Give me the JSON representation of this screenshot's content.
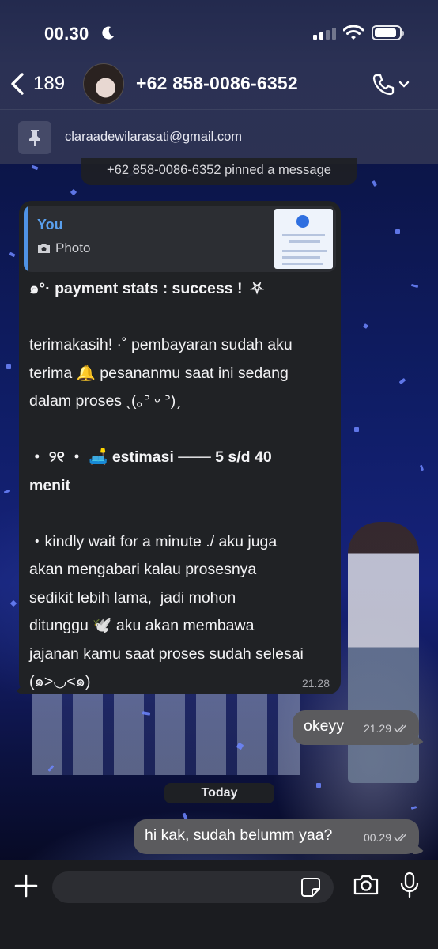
{
  "status_bar": {
    "time": "00.30",
    "icons": [
      "moon-icon",
      "signal-icon",
      "wifi-icon",
      "battery-icon"
    ]
  },
  "header": {
    "back_count": "189",
    "contact_name": "+62 858-0086-6352",
    "icons": [
      "chevron-left-icon",
      "phone-icon",
      "chevron-down-icon"
    ]
  },
  "pinned": {
    "text": "claraadewilarasati@gmail.com",
    "icon": "pin-icon"
  },
  "chat": {
    "system_notice": "+62 858-0086-6352 pinned a message",
    "incoming": {
      "reply_author": "You",
      "reply_type": "Photo",
      "lines": {
        "l1": "๑°· payment stats : success !  ⛧",
        "l2": "terimakasih! ·˚ pembayaran sudah aku",
        "l3": "terima 🔔 pesananmu saat ini sedang",
        "l4": "dalam proses ˎ(｡ᐣ ᵕ ᐣ)ˏ",
        "l5": "・ ୨୧ ・ 🛋️ estimasi ─── 5 s/d 40",
        "l6": "menit",
        "l7": "・kindly wait for a minute ./ aku juga",
        "l8": "akan mengabari kalau prosesnya",
        "l9": "sedikit lebih lama,  jadi mohon",
        "l10": "ditunggu 🕊️ aku akan membawa",
        "l11": "jajanan kamu saat proses sudah selesai",
        "l12": "(๑>◡<๑)"
      },
      "time": "21.28"
    },
    "outgoing_1": {
      "text": "okeyy",
      "time": "21.29"
    },
    "date_separator": "Today",
    "outgoing_2": {
      "text": "hi kak, sudah belumm yaa?",
      "time": "00.29"
    }
  },
  "composer": {
    "placeholder": "",
    "icons": [
      "plus-icon",
      "sticker-icon",
      "camera-icon",
      "mic-icon"
    ]
  },
  "colors": {
    "header_bg": "#2d3253",
    "incoming_bubble": "#202225",
    "outgoing_bubble": "#5b5b5e",
    "reply_accent": "#4f93e6",
    "composer_bg": "#1b1c20"
  }
}
